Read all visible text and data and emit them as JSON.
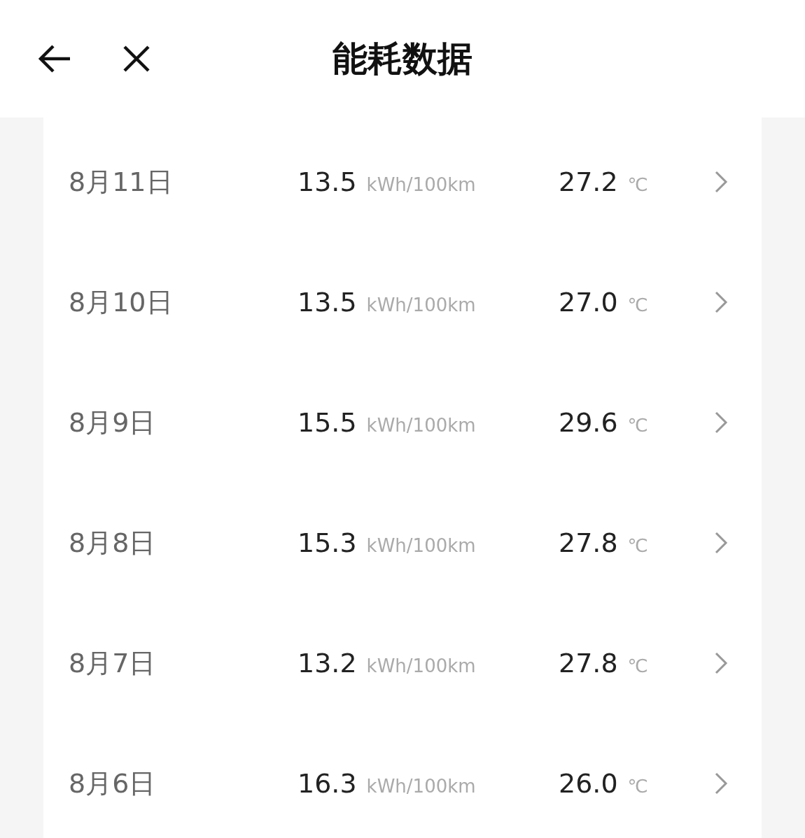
{
  "header": {
    "title": "能耗数据"
  },
  "rows": [
    {
      "date": "8月11日",
      "consumption": "13.5",
      "consumption_unit": "kWh/100km",
      "temperature": "27.2",
      "temperature_unit": "℃"
    },
    {
      "date": "8月10日",
      "consumption": "13.5",
      "consumption_unit": "kWh/100km",
      "temperature": "27.0",
      "temperature_unit": "℃"
    },
    {
      "date": "8月9日",
      "consumption": "15.5",
      "consumption_unit": "kWh/100km",
      "temperature": "29.6",
      "temperature_unit": "℃"
    },
    {
      "date": "8月8日",
      "consumption": "15.3",
      "consumption_unit": "kWh/100km",
      "temperature": "27.8",
      "temperature_unit": "℃"
    },
    {
      "date": "8月7日",
      "consumption": "13.2",
      "consumption_unit": "kWh/100km",
      "temperature": "27.8",
      "temperature_unit": "℃"
    },
    {
      "date": "8月6日",
      "consumption": "16.3",
      "consumption_unit": "kWh/100km",
      "temperature": "26.0",
      "temperature_unit": "℃"
    }
  ]
}
